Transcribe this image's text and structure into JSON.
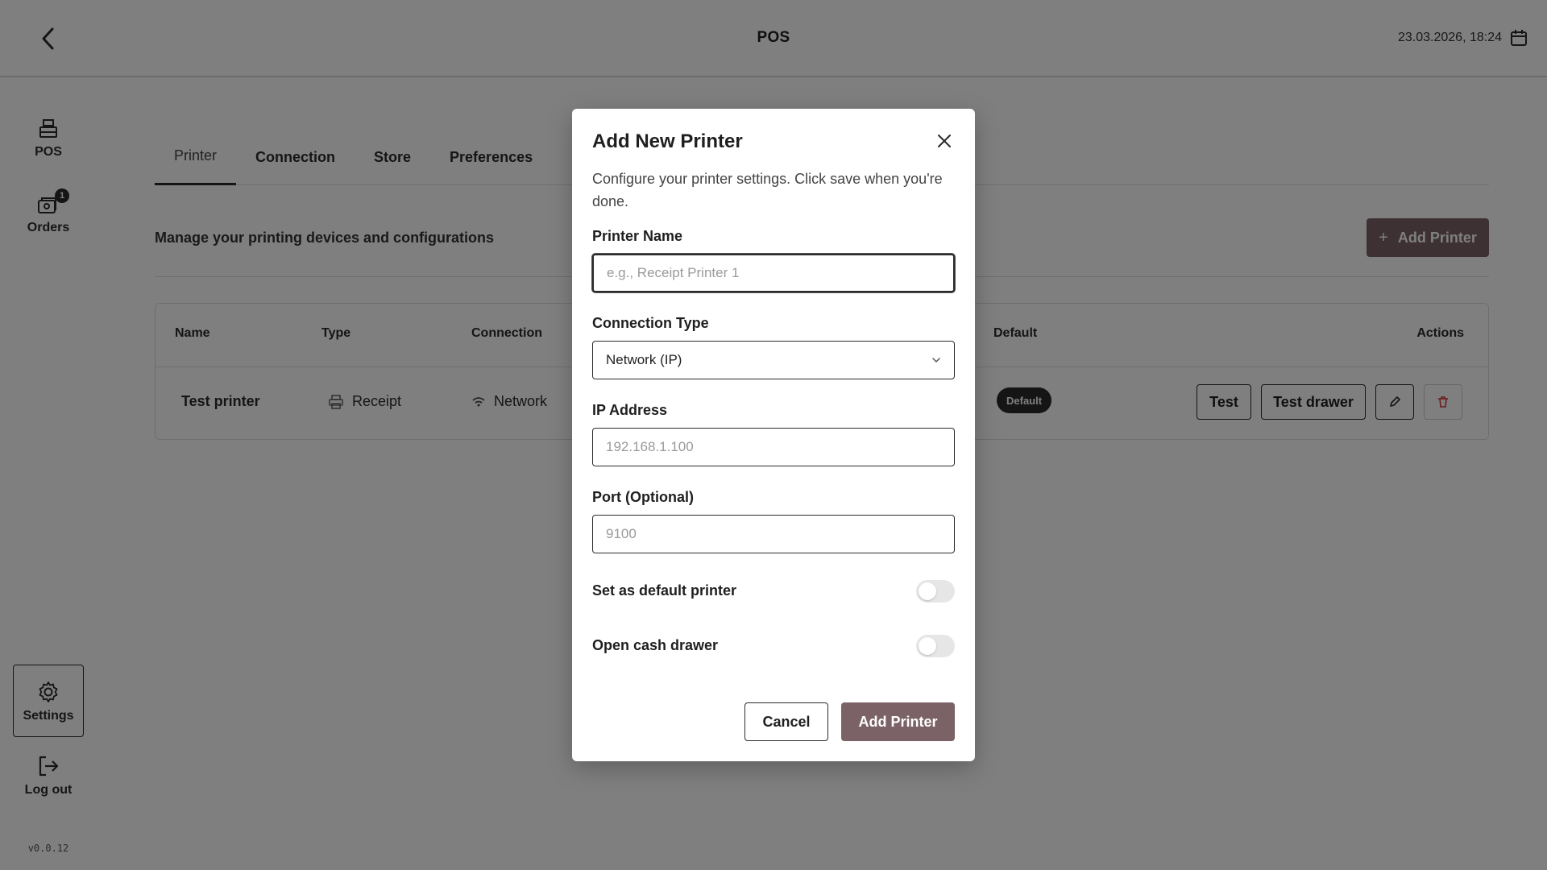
{
  "header": {
    "title": "POS",
    "datetime": "23.03.2026, 18:24"
  },
  "sidebar": {
    "items": [
      {
        "label": "POS",
        "icon": "cash-register-icon"
      },
      {
        "label": "Orders",
        "icon": "orders-icon",
        "badge": "1"
      }
    ],
    "bottom": [
      {
        "label": "Settings",
        "icon": "gear-icon"
      },
      {
        "label": "Log out",
        "icon": "logout-icon"
      }
    ],
    "version": "v0.0.12"
  },
  "main": {
    "tabs": [
      {
        "label": "Printer",
        "active": true
      },
      {
        "label": "Connection"
      },
      {
        "label": "Store"
      },
      {
        "label": "Preferences"
      }
    ],
    "subtitle": "Manage your printing devices and configurations",
    "add_button": "Add Printer",
    "table": {
      "columns": [
        "Name",
        "Type",
        "Connection",
        "Default",
        "Actions"
      ],
      "rows": [
        {
          "name": "Test printer",
          "type": "Receipt",
          "connection": "Network",
          "default": "Default",
          "actions": [
            "Test",
            "Test drawer"
          ]
        }
      ]
    }
  },
  "modal": {
    "title": "Add New Printer",
    "description": "Configure your printer settings. Click save when you're done.",
    "fields": {
      "printer_name": {
        "label": "Printer Name",
        "placeholder": "e.g., Receipt Printer 1",
        "value": ""
      },
      "connection_type": {
        "label": "Connection Type",
        "value": "Network (IP)"
      },
      "ip_address": {
        "label": "IP Address",
        "placeholder": "192.168.1.100",
        "value": ""
      },
      "port": {
        "label": "Port (Optional)",
        "placeholder": "9100",
        "value": ""
      }
    },
    "toggles": {
      "default_printer": {
        "label": "Set as default printer",
        "on": false
      },
      "open_drawer": {
        "label": "Open cash drawer",
        "on": false
      }
    },
    "cancel_label": "Cancel",
    "submit_label": "Add Printer"
  },
  "colors": {
    "accent": "#7b6267",
    "dark": "#2b2b2b",
    "overlay": "rgba(0,0,0,0.5)"
  }
}
